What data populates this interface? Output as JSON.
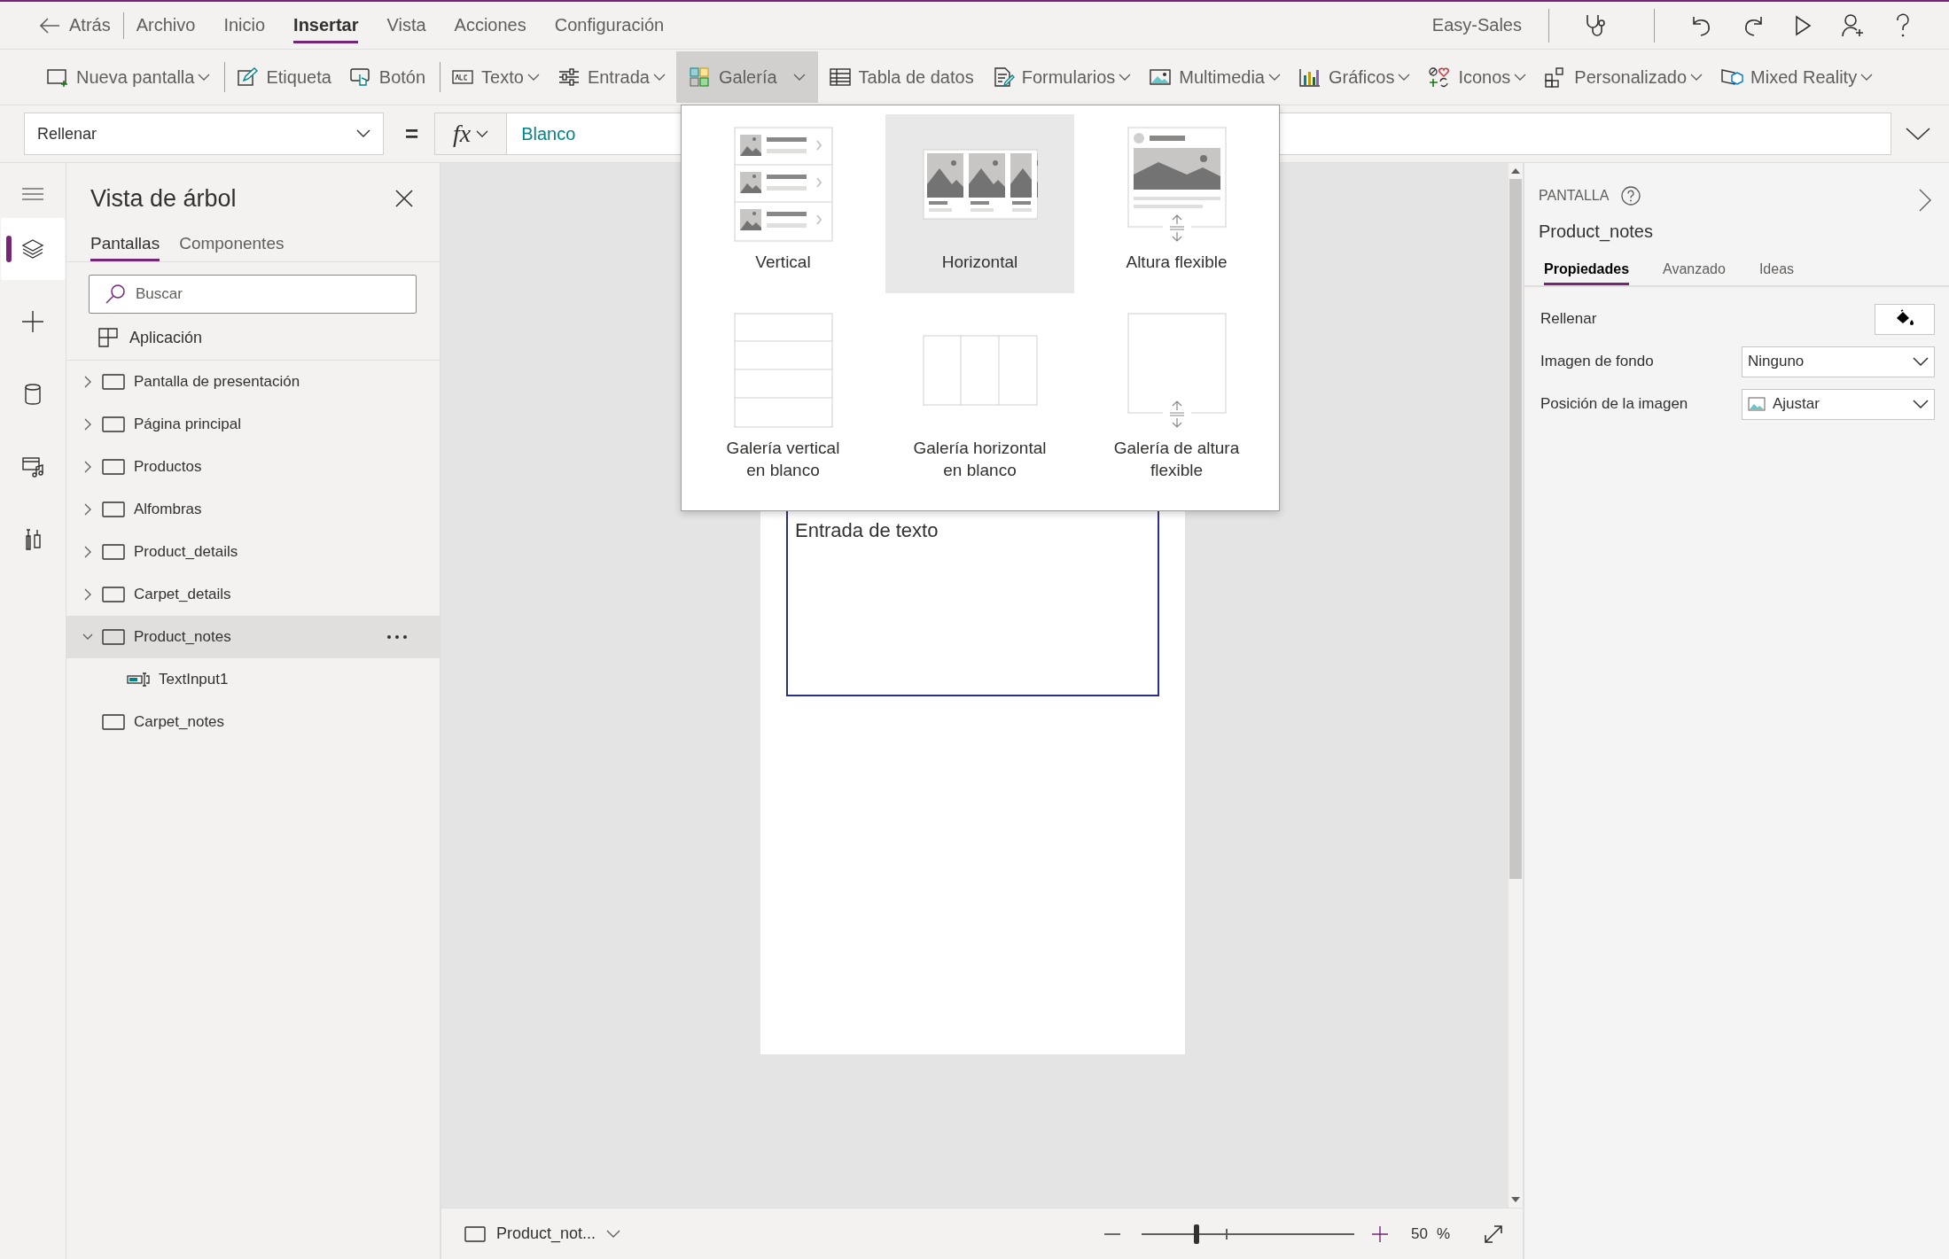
{
  "app_bar": {
    "back": "Atrás",
    "menus": [
      {
        "label": "Archivo",
        "selected": false
      },
      {
        "label": "Inicio",
        "selected": false
      },
      {
        "label": "Insertar",
        "selected": true
      },
      {
        "label": "Vista",
        "selected": false
      },
      {
        "label": "Acciones",
        "selected": false
      },
      {
        "label": "Configuración",
        "selected": false
      }
    ],
    "app_name": "Easy-Sales"
  },
  "ribbon": {
    "groups": [
      [
        {
          "kind": "screen",
          "label": "Nueva pantalla",
          "dropdown": true,
          "selected": false
        }
      ],
      [
        {
          "kind": "label",
          "label": "Etiqueta",
          "dropdown": false,
          "selected": false
        },
        {
          "kind": "button",
          "label": "Botón",
          "dropdown": false,
          "selected": false
        }
      ],
      [
        {
          "kind": "text",
          "label": "Texto",
          "dropdown": true,
          "selected": false
        },
        {
          "kind": "input",
          "label": "Entrada",
          "dropdown": true,
          "selected": false
        },
        {
          "kind": "gallery",
          "label": "Galería",
          "dropdown": true,
          "selected": true
        },
        {
          "kind": "table",
          "label": "Tabla de datos",
          "dropdown": false,
          "selected": false
        },
        {
          "kind": "form",
          "label": "Formularios",
          "dropdown": true,
          "selected": false
        },
        {
          "kind": "media",
          "label": "Multimedia",
          "dropdown": true,
          "selected": false
        },
        {
          "kind": "chart",
          "label": "Gráficos",
          "dropdown": true,
          "selected": false
        },
        {
          "kind": "icons",
          "label": "Iconos",
          "dropdown": true,
          "selected": false
        },
        {
          "kind": "custom",
          "label": "Personalizado",
          "dropdown": true,
          "selected": false
        },
        {
          "kind": "mixed",
          "label": "Mixed Reality",
          "dropdown": true,
          "selected": false
        }
      ]
    ]
  },
  "formula_bar": {
    "property": "Rellenar",
    "operator": "=",
    "fx": "fx",
    "formula": "Blanco"
  },
  "rail": [
    {
      "kind": "layers",
      "selected": true
    },
    {
      "kind": "insert",
      "selected": false
    },
    {
      "kind": "data",
      "selected": false
    },
    {
      "kind": "media",
      "selected": false
    },
    {
      "kind": "tools",
      "selected": false
    }
  ],
  "tree_view": {
    "title": "Vista de árbol",
    "tabs": [
      {
        "label": "Pantallas",
        "selected": true
      },
      {
        "label": "Componentes",
        "selected": false
      }
    ],
    "search": {
      "placeholder": "Buscar"
    },
    "app_item": "Aplicación",
    "screens": [
      {
        "label": "Pantalla de presentación",
        "expandable": true,
        "expanded": false,
        "selected": false
      },
      {
        "label": "Página principal",
        "expandable": true,
        "expanded": false,
        "selected": false
      },
      {
        "label": "Productos",
        "expandable": true,
        "expanded": false,
        "selected": false
      },
      {
        "label": "Alfombras",
        "expandable": true,
        "expanded": false,
        "selected": false
      },
      {
        "label": "Product_details",
        "expandable": true,
        "expanded": false,
        "selected": false
      },
      {
        "label": "Carpet_details",
        "expandable": true,
        "expanded": false,
        "selected": false
      },
      {
        "label": "Product_notes",
        "expandable": true,
        "expanded": true,
        "selected": true,
        "children": [
          {
            "label": "TextInput1",
            "kind": "textinput"
          }
        ]
      },
      {
        "label": "Carpet_notes",
        "expandable": false,
        "expanded": false,
        "selected": false
      }
    ]
  },
  "gallery_menu": {
    "items": [
      {
        "kind": "vertical",
        "label": "Vertical",
        "selected": false
      },
      {
        "kind": "horizontal",
        "label": "Horizontal",
        "selected": true
      },
      {
        "kind": "flexible",
        "label": "Altura flexible",
        "selected": false
      },
      {
        "kind": "blankvertical",
        "label": "Galería vertical\nen blanco",
        "selected": false
      },
      {
        "kind": "blankhorizontal",
        "label": "Galería horizontal\nen blanco",
        "selected": false
      },
      {
        "kind": "blankflexible",
        "label": "Galería de altura\nflexible",
        "selected": false
      }
    ]
  },
  "canvas": {
    "text_input": {
      "value": "Entrada de texto"
    }
  },
  "status_bar": {
    "screen": "Product_not...",
    "zoom": {
      "level": 0.26
    },
    "zoom_value": "50",
    "zoom_unit": "%"
  },
  "properties_panel": {
    "section": "PANTALLA",
    "name": "Product_notes",
    "tabs": [
      {
        "label": "Propiedades",
        "selected": true
      },
      {
        "label": "Avanzado",
        "selected": false
      },
      {
        "label": "Ideas",
        "selected": false
      }
    ],
    "rows": [
      {
        "kind": "color",
        "label": "Rellenar"
      },
      {
        "kind": "dropdown",
        "label": "Imagen de fondo",
        "value": "Ninguno"
      },
      {
        "kind": "imagedropdown",
        "label": "Posición de la imagen",
        "value": "Ajustar"
      }
    ]
  }
}
